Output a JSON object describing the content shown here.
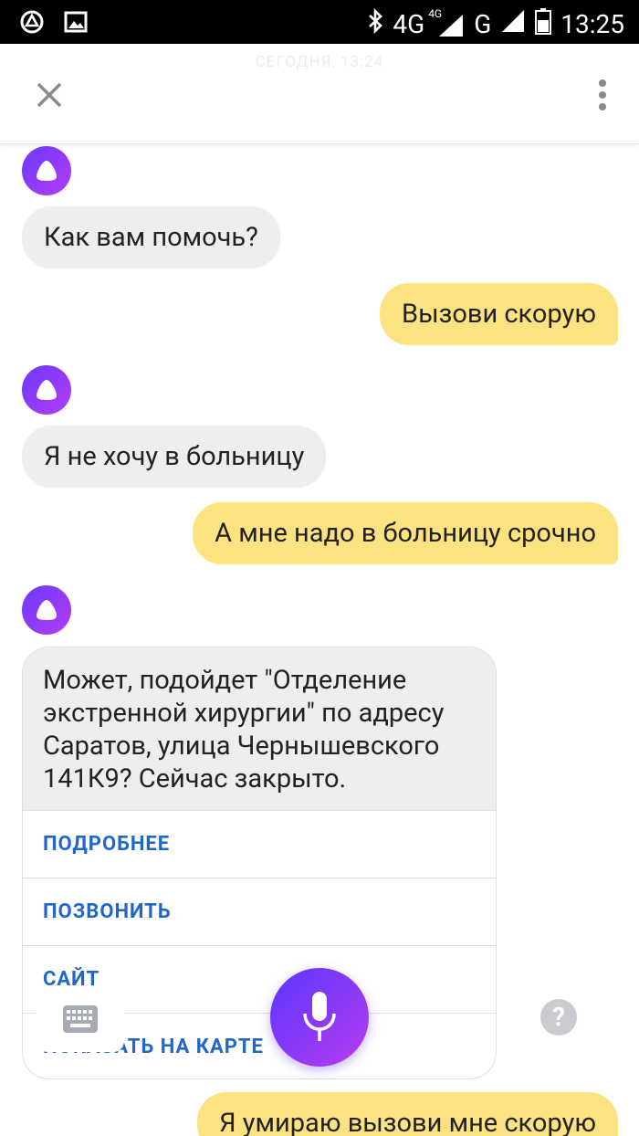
{
  "status_bar": {
    "network_4g": "4G",
    "network_4g_small": "4G",
    "network_g": "G",
    "time": "13:25"
  },
  "header": {
    "date": "СЕГОДНЯ, 13:24",
    "close_icon": "close-icon",
    "menu_icon": "more-vertical-icon"
  },
  "messages": [
    {
      "from": "alice",
      "text": "Как вам помочь?"
    },
    {
      "from": "user",
      "text": "Вызови скорую"
    },
    {
      "from": "alice",
      "text": "Я не хочу в больницу"
    },
    {
      "from": "user",
      "text": "А мне надо в больницу срочно"
    },
    {
      "from": "alice",
      "text": "Может, подойдет \"Отделение экстренной хирургии\" по адресу Саратов, улица Чернышевского 141К9? Сейчас закрыто."
    },
    {
      "from": "user",
      "text": "Я умираю вызови мне скорую"
    }
  ],
  "card_actions": {
    "details": "ПОДРОБНЕЕ",
    "call": "ПОЗВОНИТЬ",
    "site": "САЙТ",
    "map": "ПОКАЗАТЬ НА КАРТЕ"
  },
  "controls": {
    "keyboard_icon": "keyboard-icon",
    "mic_icon": "microphone-icon",
    "help_label": "?"
  },
  "colors": {
    "alice_bubble": "#eeeeef",
    "user_bubble": "#fde281",
    "accent_link": "#2067c9",
    "assistant_gradient_start": "#6b3aff",
    "assistant_gradient_end": "#b43cf0"
  }
}
